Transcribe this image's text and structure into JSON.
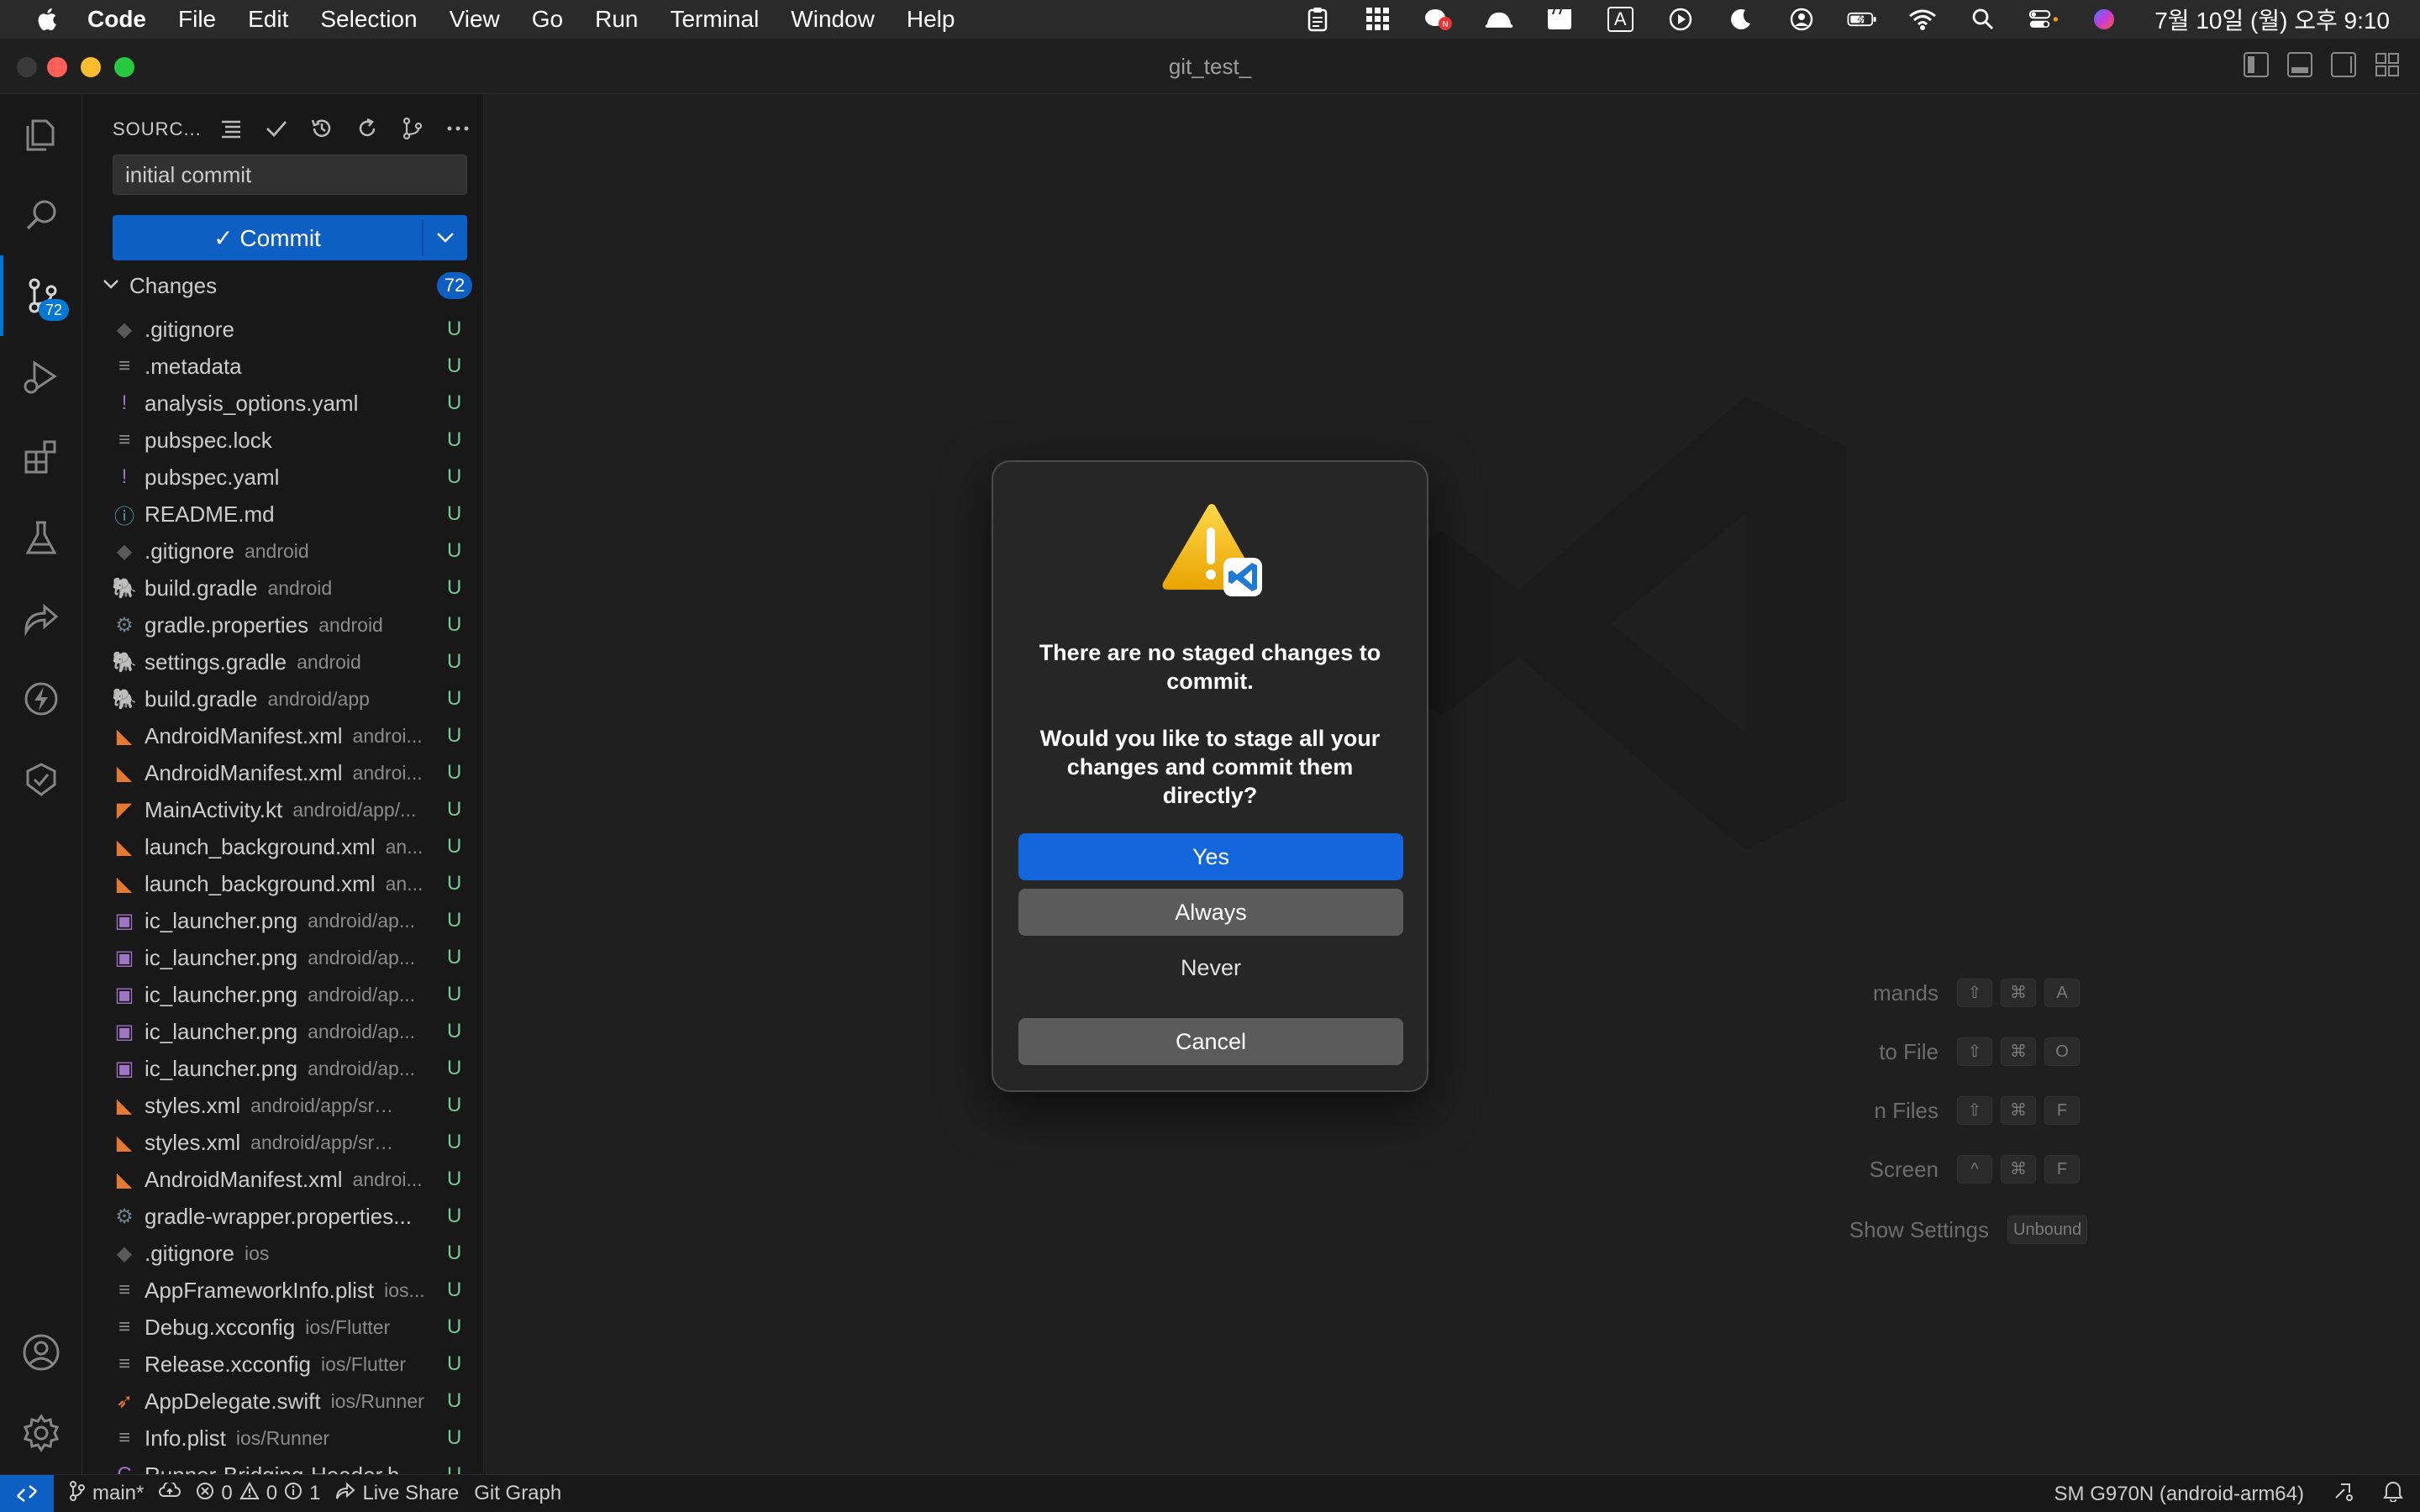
{
  "menubar": {
    "app_name": "Code",
    "menus": [
      "File",
      "Edit",
      "Selection",
      "View",
      "Go",
      "Run",
      "Terminal",
      "Window",
      "Help"
    ],
    "input_indicator": "A",
    "clock": "7월 10일 (월) 오후 9:10"
  },
  "window": {
    "title": "git_test_"
  },
  "activity_bar": {
    "scm_badge": "72"
  },
  "sidebar": {
    "title": "SOURC...",
    "commit_message": "initial commit",
    "commit_button": "✓ Commit",
    "changes_label": "Changes",
    "changes_count": "72",
    "files": [
      {
        "name": ".gitignore",
        "path": "",
        "status": "U",
        "icon": "git-icon",
        "color": "#5a5a5a"
      },
      {
        "name": ".metadata",
        "path": "",
        "status": "U",
        "icon": "lines-icon",
        "color": "#8b8b8b"
      },
      {
        "name": "analysis_options.yaml",
        "path": "",
        "status": "U",
        "icon": "yaml-icon",
        "color": "#a074c4"
      },
      {
        "name": "pubspec.lock",
        "path": "",
        "status": "U",
        "icon": "lines-icon",
        "color": "#8b8b8b"
      },
      {
        "name": "pubspec.yaml",
        "path": "",
        "status": "U",
        "icon": "yaml-icon",
        "color": "#a074c4"
      },
      {
        "name": "README.md",
        "path": "",
        "status": "U",
        "icon": "info-icon",
        "color": "#519aba"
      },
      {
        "name": ".gitignore",
        "path": "android",
        "status": "U",
        "icon": "git-icon",
        "color": "#5a5a5a"
      },
      {
        "name": "build.gradle",
        "path": "android",
        "status": "U",
        "icon": "gradle-icon",
        "color": "#519aba"
      },
      {
        "name": "gradle.properties",
        "path": "android",
        "status": "U",
        "icon": "gear-icon",
        "color": "#6d8086"
      },
      {
        "name": "settings.gradle",
        "path": "android",
        "status": "U",
        "icon": "gradle-icon",
        "color": "#519aba"
      },
      {
        "name": "build.gradle",
        "path": "android/app",
        "status": "U",
        "icon": "gradle-icon",
        "color": "#519aba"
      },
      {
        "name": "AndroidManifest.xml",
        "path": "androi...",
        "status": "U",
        "icon": "rss-icon",
        "color": "#e37933"
      },
      {
        "name": "AndroidManifest.xml",
        "path": "androi...",
        "status": "U",
        "icon": "rss-icon",
        "color": "#e37933"
      },
      {
        "name": "MainActivity.kt",
        "path": "android/app/...",
        "status": "U",
        "icon": "kotlin-icon",
        "color": "#e37933"
      },
      {
        "name": "launch_background.xml",
        "path": "an...",
        "status": "U",
        "icon": "rss-icon",
        "color": "#e37933"
      },
      {
        "name": "launch_background.xml",
        "path": "an...",
        "status": "U",
        "icon": "rss-icon",
        "color": "#e37933"
      },
      {
        "name": "ic_launcher.png",
        "path": "android/ap...",
        "status": "U",
        "icon": "image-icon",
        "color": "#a074c4"
      },
      {
        "name": "ic_launcher.png",
        "path": "android/ap...",
        "status": "U",
        "icon": "image-icon",
        "color": "#a074c4"
      },
      {
        "name": "ic_launcher.png",
        "path": "android/ap...",
        "status": "U",
        "icon": "image-icon",
        "color": "#a074c4"
      },
      {
        "name": "ic_launcher.png",
        "path": "android/ap...",
        "status": "U",
        "icon": "image-icon",
        "color": "#a074c4"
      },
      {
        "name": "ic_launcher.png",
        "path": "android/ap...",
        "status": "U",
        "icon": "image-icon",
        "color": "#a074c4"
      },
      {
        "name": "styles.xml",
        "path": "android/app/src/...",
        "status": "U",
        "icon": "rss-icon",
        "color": "#e37933"
      },
      {
        "name": "styles.xml",
        "path": "android/app/src/...",
        "status": "U",
        "icon": "rss-icon",
        "color": "#e37933"
      },
      {
        "name": "AndroidManifest.xml",
        "path": "androi...",
        "status": "U",
        "icon": "rss-icon",
        "color": "#e37933"
      },
      {
        "name": "gradle-wrapper.properties...",
        "path": "",
        "status": "U",
        "icon": "gear-icon",
        "color": "#6d8086"
      },
      {
        "name": ".gitignore",
        "path": "ios",
        "status": "U",
        "icon": "git-icon",
        "color": "#5a5a5a"
      },
      {
        "name": "AppFrameworkInfo.plist",
        "path": "ios...",
        "status": "U",
        "icon": "lines-icon",
        "color": "#8b8b8b"
      },
      {
        "name": "Debug.xcconfig",
        "path": "ios/Flutter",
        "status": "U",
        "icon": "lines-icon",
        "color": "#8b8b8b"
      },
      {
        "name": "Release.xcconfig",
        "path": "ios/Flutter",
        "status": "U",
        "icon": "lines-icon",
        "color": "#8b8b8b"
      },
      {
        "name": "AppDelegate.swift",
        "path": "ios/Runner",
        "status": "U",
        "icon": "swift-icon",
        "color": "#e37933"
      },
      {
        "name": "Info.plist",
        "path": "ios/Runner",
        "status": "U",
        "icon": "lines-icon",
        "color": "#8b8b8b"
      },
      {
        "name": "Runner-Bridging-Header.h",
        "path": "...",
        "status": "U",
        "icon": "c-icon",
        "color": "#a074c4"
      }
    ]
  },
  "editor": {
    "shortcuts": [
      {
        "label": "mands",
        "keys": [
          "⇧",
          "⌘",
          "A"
        ]
      },
      {
        "label": "to File",
        "keys": [
          "⇧",
          "⌘",
          "O"
        ]
      },
      {
        "label": "n Files",
        "keys": [
          "⇧",
          "⌘",
          "F"
        ]
      },
      {
        "label": "Screen",
        "keys": [
          "^",
          "⌘",
          "F"
        ]
      },
      {
        "label": "Show Settings",
        "keys": [
          "Unbound"
        ]
      }
    ]
  },
  "dialog": {
    "title": "There are no staged changes to commit.",
    "message": "Would you like to stage all your changes and commit them directly?",
    "yes": "Yes",
    "always": "Always",
    "never": "Never",
    "cancel": "Cancel"
  },
  "statusbar": {
    "branch": "main*",
    "errors": "0",
    "warnings": "0",
    "info": "1",
    "live_share": "Live Share",
    "git_graph": "Git Graph",
    "device": "SM G970N (android-arm64)"
  },
  "colors": {
    "accent": "#0078d4",
    "button_primary": "#1466dc",
    "untracked": "#73c991"
  }
}
